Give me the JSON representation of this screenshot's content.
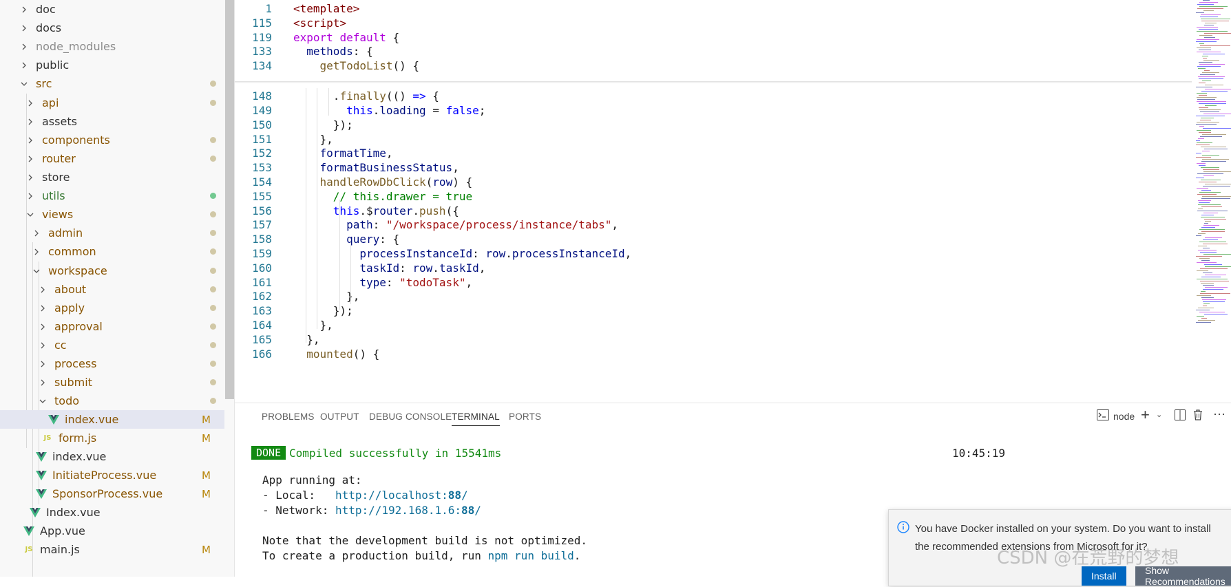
{
  "sidebar": {
    "items": [
      {
        "label": "doc",
        "type": "folder",
        "expanded": false,
        "color": "#333333",
        "status": ""
      },
      {
        "label": "docs",
        "type": "folder",
        "expanded": false,
        "color": "#333333",
        "status": ""
      },
      {
        "label": "node_modules",
        "type": "folder",
        "expanded": false,
        "color": "#8c8c8c",
        "status": ""
      },
      {
        "label": "public",
        "type": "folder",
        "expanded": false,
        "color": "#333333",
        "status": ""
      },
      {
        "label": "src",
        "type": "folder",
        "expanded": true,
        "color": "#895503",
        "status": "dot"
      },
      {
        "label": "api",
        "type": "folder",
        "expanded": false,
        "color": "#895503",
        "status": "dot"
      },
      {
        "label": "assets",
        "type": "folder",
        "expanded": false,
        "color": "#333333",
        "status": ""
      },
      {
        "label": "components",
        "type": "folder",
        "expanded": false,
        "color": "#895503",
        "status": "dot"
      },
      {
        "label": "router",
        "type": "folder",
        "expanded": false,
        "color": "#895503",
        "status": "dot"
      },
      {
        "label": "store",
        "type": "folder",
        "expanded": false,
        "color": "#333333",
        "status": ""
      },
      {
        "label": "utils",
        "type": "folder",
        "expanded": false,
        "color": "#387a34",
        "status": "dot-green"
      },
      {
        "label": "views",
        "type": "folder",
        "expanded": true,
        "color": "#895503",
        "status": "dot"
      },
      {
        "label": "admin",
        "type": "folder",
        "expanded": false,
        "color": "#895503",
        "status": "dot"
      },
      {
        "label": "common",
        "type": "folder",
        "expanded": false,
        "color": "#895503",
        "status": "dot"
      },
      {
        "label": "workspace",
        "type": "folder",
        "expanded": true,
        "color": "#895503",
        "status": "dot"
      },
      {
        "label": "about",
        "type": "folder",
        "expanded": false,
        "color": "#895503",
        "status": "dot"
      },
      {
        "label": "apply",
        "type": "folder",
        "expanded": false,
        "color": "#895503",
        "status": "dot"
      },
      {
        "label": "approval",
        "type": "folder",
        "expanded": false,
        "color": "#895503",
        "status": "dot"
      },
      {
        "label": "cc",
        "type": "folder",
        "expanded": false,
        "color": "#895503",
        "status": "dot"
      },
      {
        "label": "process",
        "type": "folder",
        "expanded": false,
        "color": "#895503",
        "status": "dot"
      },
      {
        "label": "submit",
        "type": "folder",
        "expanded": false,
        "color": "#895503",
        "status": "dot"
      },
      {
        "label": "todo",
        "type": "folder",
        "expanded": true,
        "color": "#895503",
        "status": "dot"
      },
      {
        "label": "index.vue",
        "type": "vue",
        "color": "#895503",
        "status": "M",
        "selected": true
      },
      {
        "label": "form.js",
        "type": "js",
        "color": "#895503",
        "status": "M"
      },
      {
        "label": "index.vue",
        "type": "vue",
        "color": "#333333",
        "status": ""
      },
      {
        "label": "InitiateProcess.vue",
        "type": "vue",
        "color": "#895503",
        "status": "M"
      },
      {
        "label": "SponsorProcess.vue",
        "type": "vue",
        "color": "#895503",
        "status": "M"
      },
      {
        "label": "Index.vue",
        "type": "vue",
        "color": "#333333",
        "status": ""
      },
      {
        "label": "App.vue",
        "type": "vue",
        "color": "#333333",
        "status": ""
      },
      {
        "label": "main.js",
        "type": "js",
        "color": "#333333",
        "status": "M"
      }
    ]
  },
  "editor": {
    "sticky": [
      {
        "ln": "1",
        "code": "<template>"
      },
      {
        "ln": "115",
        "code": "<script>"
      },
      {
        "ln": "119",
        "code": "export default {"
      },
      {
        "ln": "133",
        "code": "  methods: {"
      },
      {
        "ln": "134",
        "code": "    getTodoList() {"
      }
    ],
    "lines": [
      {
        "ln": "148",
        "code": "      .finally(() => {"
      },
      {
        "ln": "149",
        "code": "        this.loading = false;"
      },
      {
        "ln": "150",
        "code": "      });"
      },
      {
        "ln": "151",
        "code": "    },"
      },
      {
        "ln": "152",
        "code": "    formatTime,"
      },
      {
        "ln": "153",
        "code": "    formatBusinessStatus,"
      },
      {
        "ln": "154",
        "code": "    handleRowDbClick(row) {"
      },
      {
        "ln": "155",
        "code": "      // this.drawer = true"
      },
      {
        "ln": "156",
        "code": "      this.$router.push({"
      },
      {
        "ln": "157",
        "code": "        path: \"/workspace/process/instance/tabs\","
      },
      {
        "ln": "158",
        "code": "        query: {"
      },
      {
        "ln": "159",
        "code": "          processInstanceId: row.processInstanceId,"
      },
      {
        "ln": "160",
        "code": "          taskId: row.taskId,"
      },
      {
        "ln": "161",
        "code": "          type: \"todoTask\","
      },
      {
        "ln": "162",
        "code": "        },"
      },
      {
        "ln": "163",
        "code": "      });"
      },
      {
        "ln": "164",
        "code": "    },"
      },
      {
        "ln": "165",
        "code": "  },"
      },
      {
        "ln": "166",
        "code": "  mounted() {"
      }
    ]
  },
  "panel": {
    "tabs": [
      "PROBLEMS",
      "OUTPUT",
      "DEBUG CONSOLE",
      "TERMINAL",
      "PORTS"
    ],
    "active_tab": "TERMINAL",
    "terminal_name": "node",
    "terminal": {
      "done_label": "DONE",
      "compiled": "Compiled successfully in 15541ms",
      "time": "10:45:19",
      "running": "App running at:",
      "local_label": "- Local:   ",
      "local_url": "http://localhost:",
      "local_port": "88",
      "network_label": "- Network: ",
      "network_url": "http://192.168.1.6:",
      "network_port": "88",
      "note1": "Note that the development build is not optimized.",
      "note2_pre": "To create a production build, run ",
      "note2_cmd": "npm run build",
      "note2_post": "."
    }
  },
  "notification": {
    "message": "You have Docker installed on your system. Do you want to install the recommended extensions from Microsoft for it?",
    "install_label": "Install",
    "show_label": "Show Recommendations"
  },
  "watermark": "CSDN @在荒野的梦想"
}
